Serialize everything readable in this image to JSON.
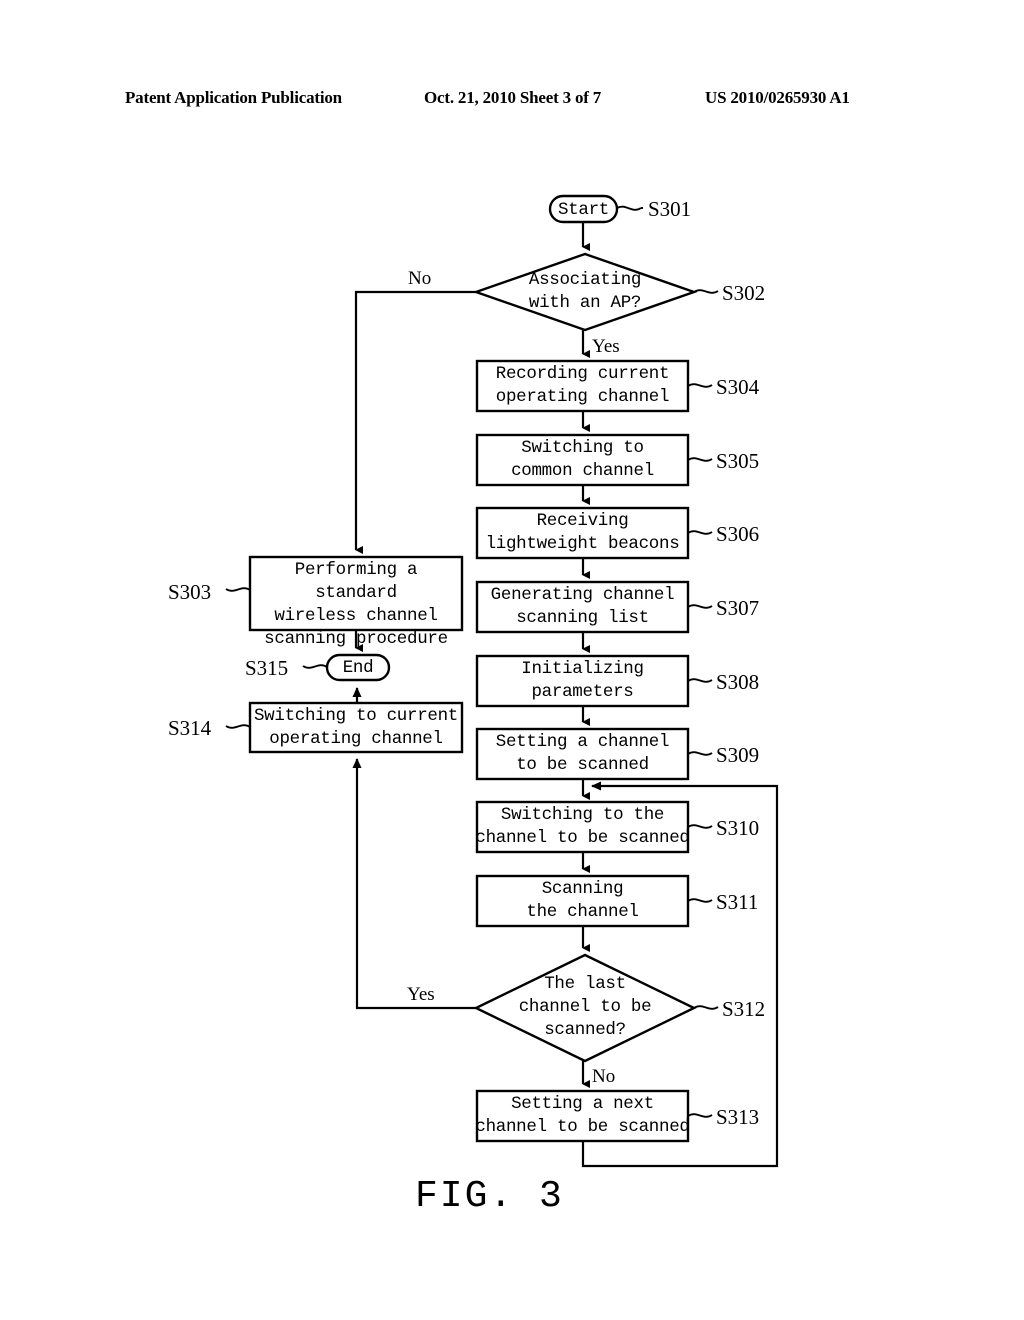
{
  "header": {
    "left": "Patent Application Publication",
    "center": "Oct. 21, 2010  Sheet 3 of 7",
    "right": "US 2010/0265930 A1"
  },
  "figure": {
    "caption": "FIG.  3",
    "type": "flowchart"
  },
  "nodes": [
    {
      "id": "S301",
      "shape": "terminator",
      "tag": "S301",
      "text": "Start"
    },
    {
      "id": "S302",
      "shape": "decision",
      "tag": "S302",
      "text": "Associating\nwith an AP?"
    },
    {
      "id": "S303",
      "shape": "process",
      "tag": "S303",
      "text": "Performing a standard\nwireless channel\nscanning procedure"
    },
    {
      "id": "S304",
      "shape": "process",
      "tag": "S304",
      "text": "Recording current\noperating channel"
    },
    {
      "id": "S305",
      "shape": "process",
      "tag": "S305",
      "text": "Switching to\ncommon channel"
    },
    {
      "id": "S306",
      "shape": "process",
      "tag": "S306",
      "text": "Receiving\nlightweight beacons"
    },
    {
      "id": "S307",
      "shape": "process",
      "tag": "S307",
      "text": "Generating channel\nscanning list"
    },
    {
      "id": "S308",
      "shape": "process",
      "tag": "S308",
      "text": "Initializing\nparameters"
    },
    {
      "id": "S309",
      "shape": "process",
      "tag": "S309",
      "text": "Setting a channel\nto be scanned"
    },
    {
      "id": "S310",
      "shape": "process",
      "tag": "S310",
      "text": "Switching to the\nchannel to be scanned"
    },
    {
      "id": "S311",
      "shape": "process",
      "tag": "S311",
      "text": "Scanning\nthe channel"
    },
    {
      "id": "S312",
      "shape": "decision",
      "tag": "S312",
      "text": "The last\nchannel to be\nscanned?"
    },
    {
      "id": "S313",
      "shape": "process",
      "tag": "S313",
      "text": "Setting a next\nchannel to be scanned"
    },
    {
      "id": "S314",
      "shape": "process",
      "tag": "S314",
      "text": "Switching to current\noperating channel"
    },
    {
      "id": "S315",
      "shape": "terminator",
      "tag": "S315",
      "text": "End"
    }
  ],
  "branch_labels": {
    "s302_no": "No",
    "s302_yes": "Yes",
    "s312_yes": "Yes",
    "s312_no": "No"
  },
  "colors": {
    "stroke": "#000000",
    "fill": "#ffffff",
    "background": "#ffffff"
  }
}
